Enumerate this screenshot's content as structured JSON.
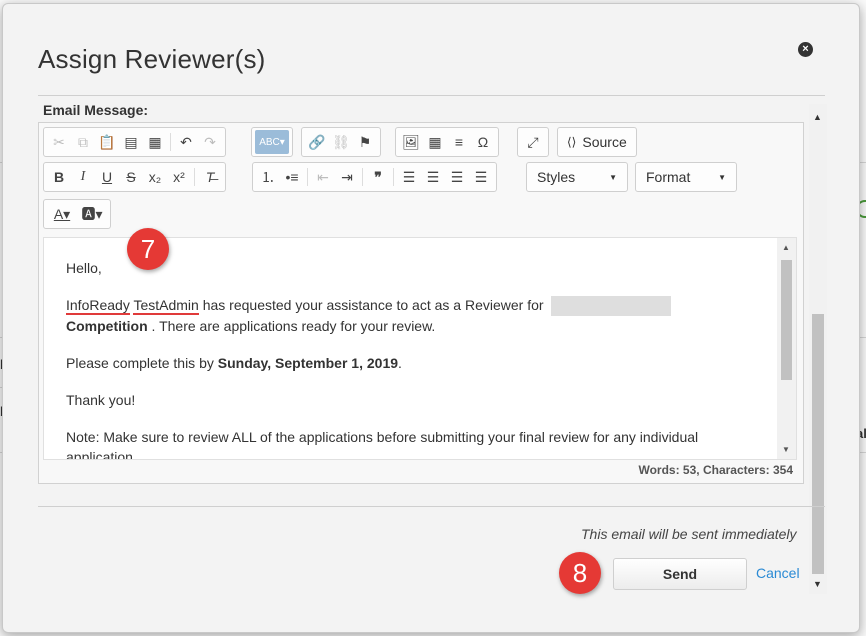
{
  "dialog": {
    "title": "Assign Reviewer(s)",
    "close_icon": "close-icon",
    "email_label": "Email Message:"
  },
  "toolbar": {
    "source_label": "Source",
    "styles_label": "Styles",
    "format_label": "Format",
    "icons": [
      "cut-icon",
      "copy-icon",
      "paste-icon",
      "paste-text-icon",
      "paste-word-icon",
      "undo-icon",
      "redo-icon",
      "spellcheck-icon",
      "link-icon",
      "unlink-icon",
      "anchor-icon",
      "image-icon",
      "table-icon",
      "horizontal-rule-icon",
      "special-char-icon",
      "maximize-icon",
      "source-icon",
      "bold-icon",
      "italic-icon",
      "underline-icon",
      "strike-icon",
      "subscript-icon",
      "superscript-icon",
      "remove-format-icon",
      "numbered-list-icon",
      "bullet-list-icon",
      "outdent-icon",
      "indent-icon",
      "blockquote-icon",
      "align-left-icon",
      "align-center-icon",
      "align-right-icon",
      "justify-icon",
      "text-color-icon",
      "bg-color-icon"
    ]
  },
  "message": {
    "greeting": "Hello,",
    "line1_name1": "InfoReady",
    "line1_name2": "TestAdmin",
    "line1_text": " has requested your assistance to act as a Reviewer for ",
    "line1_competition": "Competition",
    "line1_end": " . There are applications ready for your review.",
    "line2_text": "Please complete this by ",
    "line2_date": "Sunday, September 1, 2019",
    "line2_end": ".",
    "thanks": "Thank you!",
    "note": "Note: Make sure to review ALL of the applications before submitting your final review for any individual application."
  },
  "wordcount": "Words: 53, Characters: 354",
  "footer": {
    "notice": "This email will be sent immediately",
    "send_label": "Send",
    "cancel_label": "Cancel"
  },
  "badges": {
    "step7": "7",
    "step8": "8"
  },
  "background": {
    "frag1": "al",
    "frag2": "b",
    "frag3": "b"
  },
  "colors": {
    "badge": "#e53935",
    "link": "#2a8ad4",
    "spell_underline": "#e03a3a"
  }
}
